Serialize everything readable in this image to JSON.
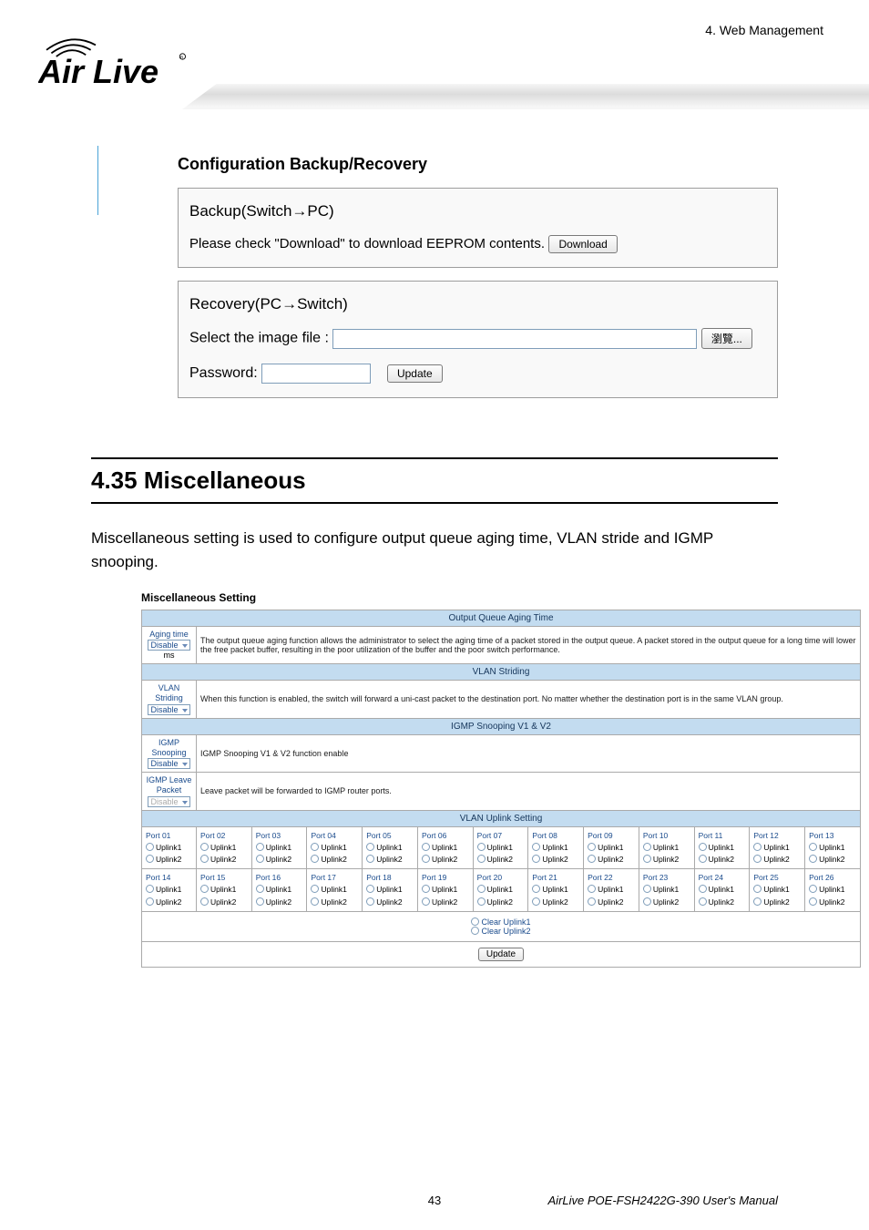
{
  "header_chapter": "4.  Web Management",
  "logo_text": "Air Live",
  "backup_recovery": {
    "title": "Configuration Backup/Recovery",
    "backup_panel_title": "Backup(Switch→PC)",
    "backup_instruction": "Please check \"Download\" to download EEPROM contents.",
    "download_label": "Download",
    "recovery_panel_title": "Recovery(PC→Switch)",
    "select_file_label": "Select the image file :",
    "browse_label": "瀏覽...",
    "password_label": "Password:",
    "update_label": "Update"
  },
  "chapter": {
    "heading": "4.35 Miscellaneous",
    "paragraph": "Miscellaneous setting is used to configure output queue aging time, VLAN stride and IGMP snooping."
  },
  "misc": {
    "title": "Miscellaneous Setting",
    "band_output": "Output Queue Aging Time",
    "aging_label": "Aging time",
    "disable_value": "Disable",
    "ms_label": "ms",
    "aging_desc": "The output queue aging function allows the administrator to select the aging time of a packet stored in the output queue. A packet stored in the output queue for a long time will lower the free packet buffer, resulting in the poor utilization of the buffer and the poor switch performance.",
    "band_vlan_striding": "VLAN Striding",
    "vlan_striding_label": "VLAN Striding",
    "vlan_striding_desc": "When this function is enabled, the switch will forward a uni-cast packet to the destination port. No matter whether the destination port is in the same VLAN group.",
    "band_igmp": "IGMP Snooping V1 & V2",
    "igmp_snoop_label": "IGMP Snooping",
    "igmp_snoop_desc": "IGMP Snooping V1 & V2 function enable",
    "igmp_leave_label": "IGMP Leave Packet",
    "igmp_leave_desc": "Leave packet will be forwarded to IGMP router ports.",
    "band_uplink": "VLAN Uplink Setting",
    "uplink1": "Uplink1",
    "uplink2": "Uplink2",
    "ports_row1": [
      "Port 01",
      "Port 02",
      "Port 03",
      "Port 04",
      "Port 05",
      "Port 06",
      "Port 07",
      "Port 08",
      "Port 09",
      "Port 10",
      "Port 11",
      "Port 12",
      "Port 13"
    ],
    "ports_row2": [
      "Port 14",
      "Port 15",
      "Port 16",
      "Port 17",
      "Port 18",
      "Port 19",
      "Port 20",
      "Port 21",
      "Port 22",
      "Port 23",
      "Port 24",
      "Port 25",
      "Port 26"
    ],
    "clear1": "Clear Uplink1",
    "clear2": "Clear Uplink2",
    "update_label": "Update"
  },
  "footer": {
    "page_num": "43",
    "manual": "AirLive POE-FSH2422G-390 User's Manual"
  }
}
